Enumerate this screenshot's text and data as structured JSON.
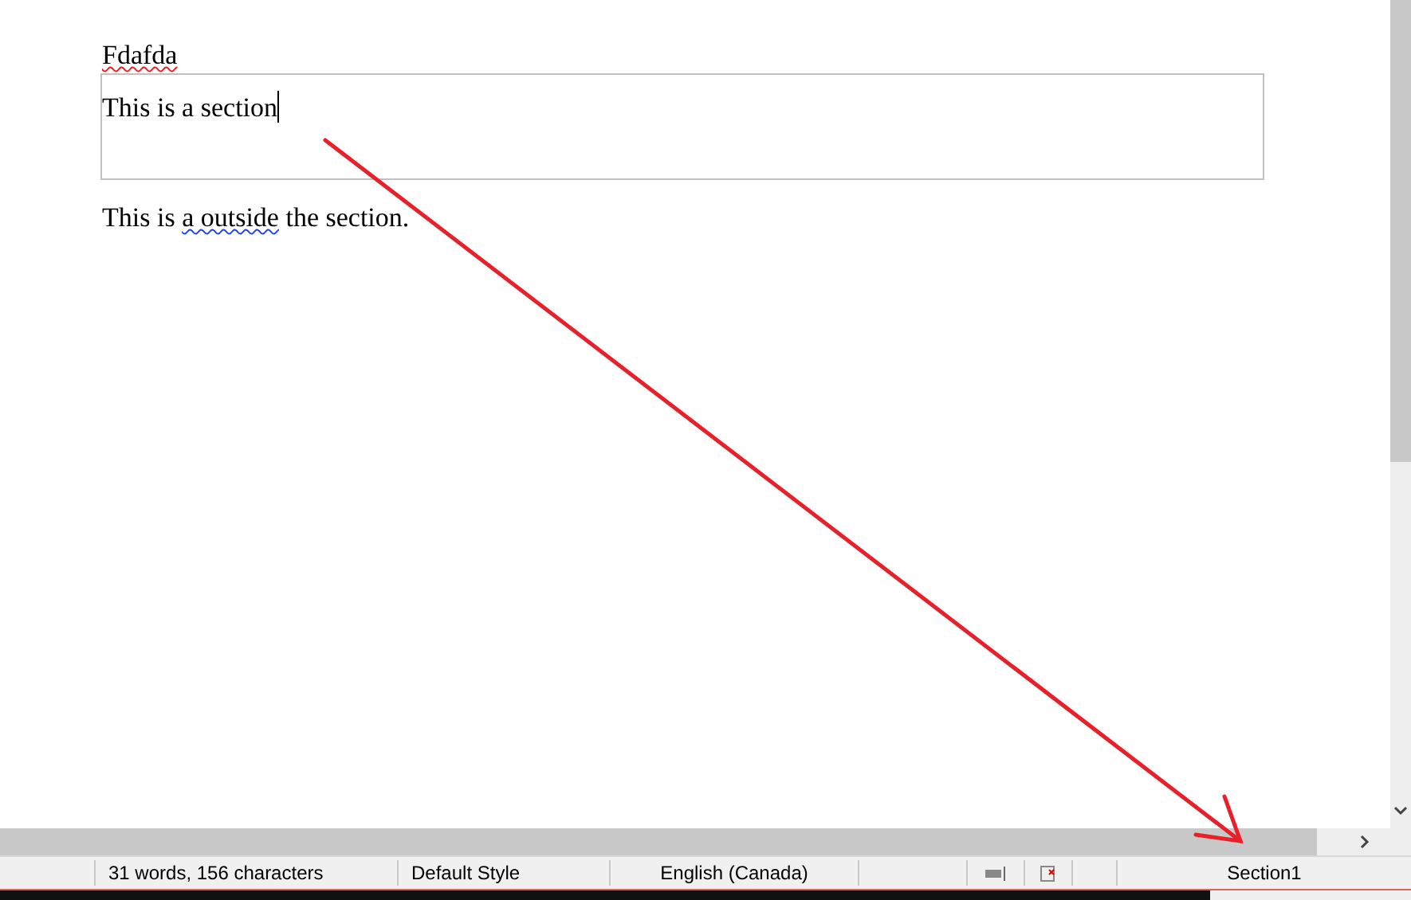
{
  "document": {
    "heading": {
      "text": "Fdafda",
      "spelling_error": true
    },
    "section": {
      "text": "This is a section",
      "cursor": true
    },
    "paragraph": [
      {
        "text": "This is ",
        "grammar_error": false
      },
      {
        "text": "a outside",
        "grammar_error": true
      },
      {
        "text": " the section.",
        "grammar_error": false
      }
    ]
  },
  "status_bar": {
    "word_count": "31 words, 156 characters",
    "page_style": "Default Style",
    "language": "English (Canada)",
    "section": "Section1"
  }
}
